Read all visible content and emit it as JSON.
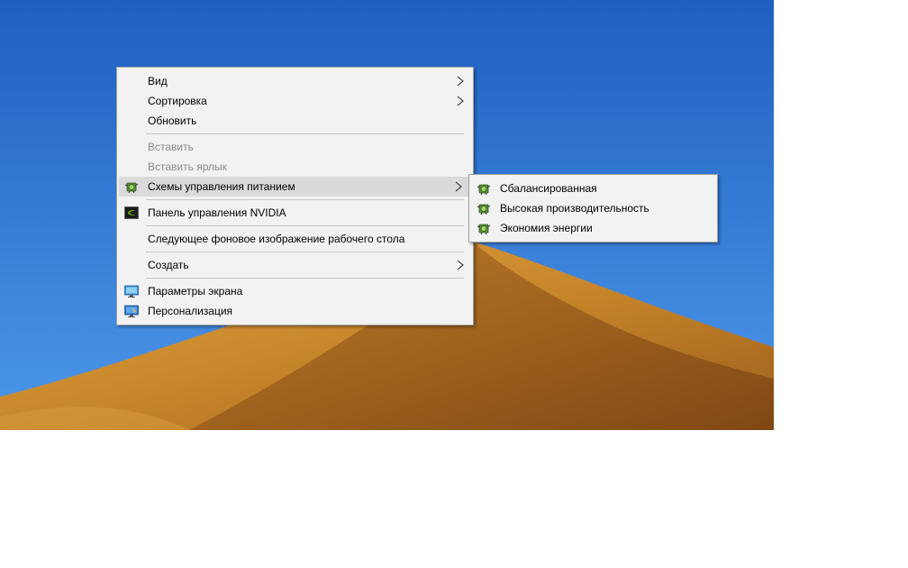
{
  "context_menu": {
    "items": [
      {
        "label": "Вид"
      },
      {
        "label": "Сортировка"
      },
      {
        "label": "Обновить"
      },
      {
        "label": "Вставить"
      },
      {
        "label": "Вставить ярлык"
      },
      {
        "label": "Схемы управления питанием"
      },
      {
        "label": "Панель управления NVIDIA"
      },
      {
        "label": "Следующее фоновое изображение рабочего стола"
      },
      {
        "label": "Создать"
      },
      {
        "label": "Параметры экрана"
      },
      {
        "label": "Персонализация"
      }
    ],
    "highlighted_index": 5
  },
  "power_submenu": {
    "items": [
      {
        "label": "Сбалансированная"
      },
      {
        "label": "Высокая производительность"
      },
      {
        "label": "Экономия энергии"
      }
    ]
  },
  "icons": {
    "power_plan": "power-plan-icon",
    "nvidia": "nvidia-icon",
    "display": "display-settings-icon",
    "personalize": "personalization-icon",
    "submenu_arrow": "chevron-right-icon"
  },
  "colors": {
    "menu_background": "#f2f2f2",
    "highlight": "#dadada",
    "disabled_text": "#8a8a8a",
    "sky": "#2f7bd9",
    "dune": "#c8862a"
  }
}
